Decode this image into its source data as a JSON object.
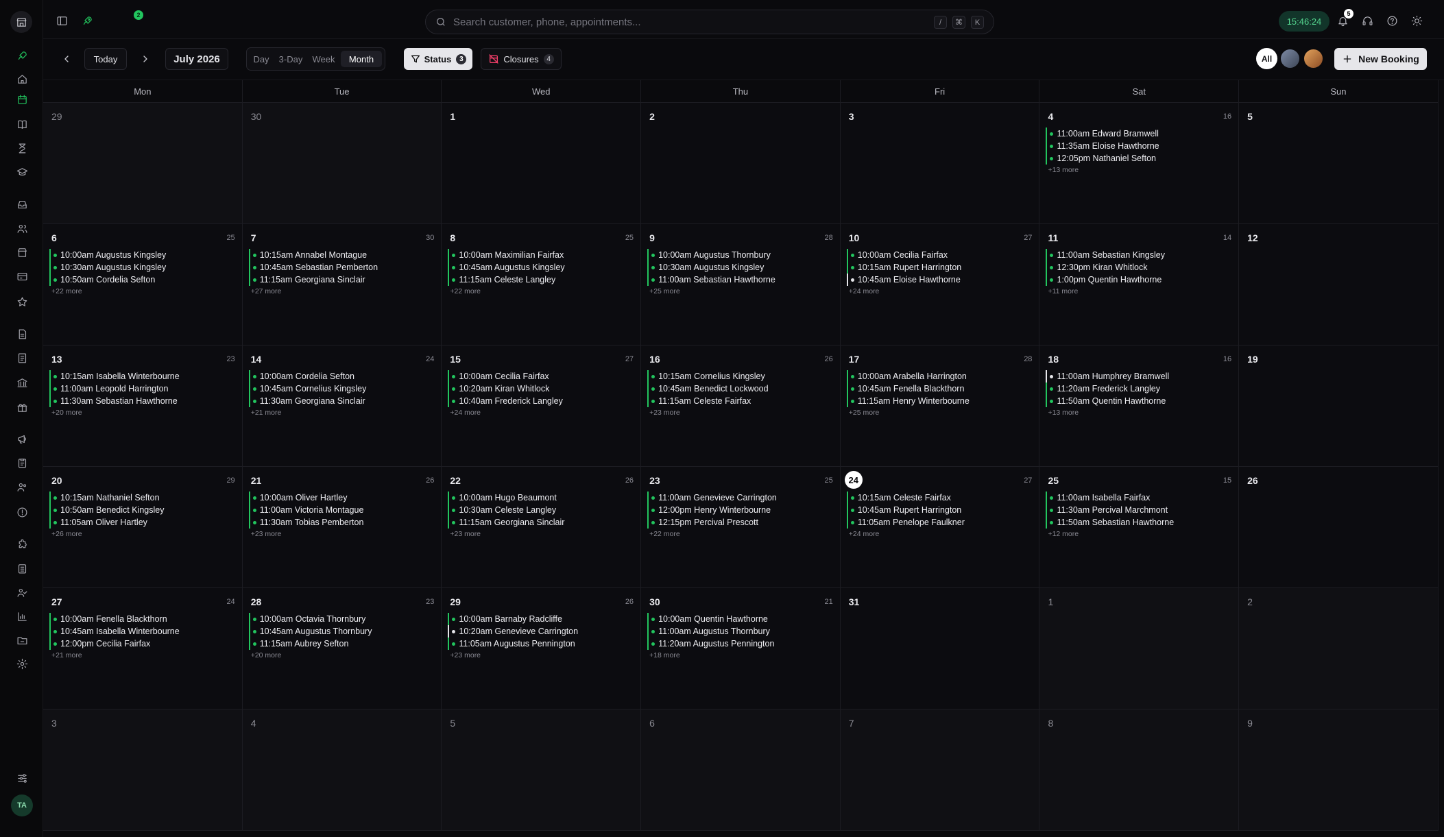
{
  "topbar": {
    "search_placeholder": "Search customer, phone, appointments...",
    "rocket_badge": "2",
    "kbd": [
      "/",
      "⌘",
      "K"
    ],
    "clock": "15:46:24",
    "bell_badge": "5"
  },
  "toolbar": {
    "today": "Today",
    "month": "July 2026",
    "views": [
      "Day",
      "3-Day",
      "Week",
      "Month"
    ],
    "active_view": "Month",
    "status_label": "Status",
    "status_count": "3",
    "closures_label": "Closures",
    "closures_count": "4",
    "staff_all": "All",
    "new_booking": "New Booking"
  },
  "sidebar": {
    "avatar": "TA",
    "icons": [
      "rocket-icon",
      "home-icon",
      "calendar-icon",
      "book-icon",
      "hourglass-icon",
      "graduation-icon",
      "inbox-icon",
      "users-icon",
      "store-icon",
      "gift-card-icon",
      "star-icon",
      "file-icon",
      "invoice-icon",
      "bank-icon",
      "gift-icon",
      "megaphone-icon",
      "clipboard-icon",
      "team-icon",
      "alert-icon",
      "puzzle-icon",
      "list-icon",
      "user-check-icon",
      "chart-icon",
      "folder-icon",
      "gear-icon",
      "sliders-icon"
    ]
  },
  "calendar": {
    "days_of_week": [
      "Mon",
      "Tue",
      "Wed",
      "Thu",
      "Fri",
      "Sat",
      "Sun"
    ],
    "weeks": [
      [
        {
          "d": "29",
          "other": true
        },
        {
          "d": "30",
          "other": true
        },
        {
          "d": "1"
        },
        {
          "d": "2"
        },
        {
          "d": "3"
        },
        {
          "d": "4",
          "count": "16",
          "appts": [
            [
              "11:00am Edward Bramwell",
              "g"
            ],
            [
              "11:35am Eloise Hawthorne",
              "g"
            ],
            [
              "12:05pm Nathaniel Sefton",
              "g"
            ]
          ],
          "more": "+13 more"
        },
        {
          "d": "5"
        }
      ],
      [
        {
          "d": "6",
          "count": "25",
          "appts": [
            [
              "10:00am Augustus Kingsley",
              "g"
            ],
            [
              "10:30am Augustus Kingsley",
              "g"
            ],
            [
              "10:50am Cordelia Sefton",
              "g"
            ]
          ],
          "more": "+22 more"
        },
        {
          "d": "7",
          "count": "30",
          "appts": [
            [
              "10:15am Annabel Montague",
              "g"
            ],
            [
              "10:45am Sebastian Pemberton",
              "g"
            ],
            [
              "11:15am Georgiana Sinclair",
              "g"
            ]
          ],
          "more": "+27 more"
        },
        {
          "d": "8",
          "count": "25",
          "appts": [
            [
              "10:00am Maximilian Fairfax",
              "g"
            ],
            [
              "10:45am Augustus Kingsley",
              "g"
            ],
            [
              "11:15am Celeste Langley",
              "g"
            ]
          ],
          "more": "+22 more"
        },
        {
          "d": "9",
          "count": "28",
          "appts": [
            [
              "10:00am Augustus Thornbury",
              "g"
            ],
            [
              "10:30am Augustus Kingsley",
              "g"
            ],
            [
              "11:00am Sebastian Hawthorne",
              "g"
            ]
          ],
          "more": "+25 more"
        },
        {
          "d": "10",
          "count": "27",
          "appts": [
            [
              "10:00am Cecilia Fairfax",
              "g"
            ],
            [
              "10:15am Rupert Harrington",
              "g"
            ],
            [
              "10:45am Eloise Hawthorne",
              "w"
            ]
          ],
          "more": "+24 more"
        },
        {
          "d": "11",
          "count": "14",
          "appts": [
            [
              "11:00am Sebastian Kingsley",
              "g"
            ],
            [
              "12:30pm Kiran Whitlock",
              "g"
            ],
            [
              "1:00pm Quentin Hawthorne",
              "g"
            ]
          ],
          "more": "+11 more"
        },
        {
          "d": "12"
        }
      ],
      [
        {
          "d": "13",
          "count": "23",
          "appts": [
            [
              "10:15am Isabella Winterbourne",
              "g"
            ],
            [
              "11:00am Leopold Harrington",
              "g"
            ],
            [
              "11:30am Sebastian Hawthorne",
              "g"
            ]
          ],
          "more": "+20 more"
        },
        {
          "d": "14",
          "count": "24",
          "appts": [
            [
              "10:00am Cordelia Sefton",
              "g"
            ],
            [
              "10:45am Cornelius Kingsley",
              "g"
            ],
            [
              "11:30am Georgiana Sinclair",
              "g"
            ]
          ],
          "more": "+21 more"
        },
        {
          "d": "15",
          "count": "27",
          "appts": [
            [
              "10:00am Cecilia Fairfax",
              "g"
            ],
            [
              "10:20am Kiran Whitlock",
              "g"
            ],
            [
              "10:40am Frederick Langley",
              "g"
            ]
          ],
          "more": "+24 more"
        },
        {
          "d": "16",
          "count": "26",
          "appts": [
            [
              "10:15am Cornelius Kingsley",
              "g"
            ],
            [
              "10:45am Benedict Lockwood",
              "g"
            ],
            [
              "11:15am Celeste Fairfax",
              "g"
            ]
          ],
          "more": "+23 more"
        },
        {
          "d": "17",
          "count": "28",
          "appts": [
            [
              "10:00am Arabella Harrington",
              "g"
            ],
            [
              "10:45am Fenella Blackthorn",
              "g"
            ],
            [
              "11:15am Henry Winterbourne",
              "g"
            ]
          ],
          "more": "+25 more"
        },
        {
          "d": "18",
          "count": "16",
          "appts": [
            [
              "11:00am Humphrey Bramwell",
              "w"
            ],
            [
              "11:20am Frederick Langley",
              "g"
            ],
            [
              "11:50am Quentin Hawthorne",
              "g"
            ]
          ],
          "more": "+13 more"
        },
        {
          "d": "19"
        }
      ],
      [
        {
          "d": "20",
          "count": "29",
          "appts": [
            [
              "10:15am Nathaniel Sefton",
              "g"
            ],
            [
              "10:50am Benedict Kingsley",
              "g"
            ],
            [
              "11:05am Oliver Hartley",
              "g"
            ]
          ],
          "more": "+26 more"
        },
        {
          "d": "21",
          "count": "26",
          "appts": [
            [
              "10:00am Oliver Hartley",
              "g"
            ],
            [
              "11:00am Victoria Montague",
              "g"
            ],
            [
              "11:30am Tobias Pemberton",
              "g"
            ]
          ],
          "more": "+23 more"
        },
        {
          "d": "22",
          "count": "26",
          "appts": [
            [
              "10:00am Hugo Beaumont",
              "g"
            ],
            [
              "10:30am Celeste Langley",
              "g"
            ],
            [
              "11:15am Georgiana Sinclair",
              "g"
            ]
          ],
          "more": "+23 more"
        },
        {
          "d": "23",
          "count": "25",
          "appts": [
            [
              "11:00am Genevieve Carrington",
              "g"
            ],
            [
              "12:00pm Henry Winterbourne",
              "g"
            ],
            [
              "12:15pm Percival Prescott",
              "g"
            ]
          ],
          "more": "+22 more"
        },
        {
          "d": "24",
          "today": true,
          "count": "27",
          "appts": [
            [
              "10:15am Celeste Fairfax",
              "g"
            ],
            [
              "10:45am Rupert Harrington",
              "g"
            ],
            [
              "11:05am Penelope Faulkner",
              "g"
            ]
          ],
          "more": "+24 more"
        },
        {
          "d": "25",
          "count": "15",
          "appts": [
            [
              "11:00am Isabella Fairfax",
              "g"
            ],
            [
              "11:30am Percival Marchmont",
              "g"
            ],
            [
              "11:50am Sebastian Hawthorne",
              "g"
            ]
          ],
          "more": "+12 more"
        },
        {
          "d": "26"
        }
      ],
      [
        {
          "d": "27",
          "count": "24",
          "appts": [
            [
              "10:00am Fenella Blackthorn",
              "g"
            ],
            [
              "10:45am Isabella Winterbourne",
              "g"
            ],
            [
              "12:00pm Cecilia Fairfax",
              "g"
            ]
          ],
          "more": "+21 more"
        },
        {
          "d": "28",
          "count": "23",
          "appts": [
            [
              "10:00am Octavia Thornbury",
              "g"
            ],
            [
              "10:45am Augustus Thornbury",
              "g"
            ],
            [
              "11:15am Aubrey Sefton",
              "g"
            ]
          ],
          "more": "+20 more"
        },
        {
          "d": "29",
          "count": "26",
          "appts": [
            [
              "10:00am Barnaby Radcliffe",
              "g"
            ],
            [
              "10:20am Genevieve Carrington",
              "w"
            ],
            [
              "11:05am Augustus Pennington",
              "g"
            ]
          ],
          "more": "+23 more"
        },
        {
          "d": "30",
          "count": "21",
          "appts": [
            [
              "10:00am Quentin Hawthorne",
              "g"
            ],
            [
              "11:00am Augustus Thornbury",
              "g"
            ],
            [
              "11:20am Augustus Pennington",
              "g"
            ]
          ],
          "more": "+18 more"
        },
        {
          "d": "31"
        },
        {
          "d": "1",
          "other": true
        },
        {
          "d": "2",
          "other": true
        }
      ],
      [
        {
          "d": "3",
          "other": true
        },
        {
          "d": "4",
          "other": true
        },
        {
          "d": "5",
          "other": true
        },
        {
          "d": "6",
          "other": true
        },
        {
          "d": "7",
          "other": true
        },
        {
          "d": "8",
          "other": true
        },
        {
          "d": "9",
          "other": true
        }
      ]
    ]
  }
}
